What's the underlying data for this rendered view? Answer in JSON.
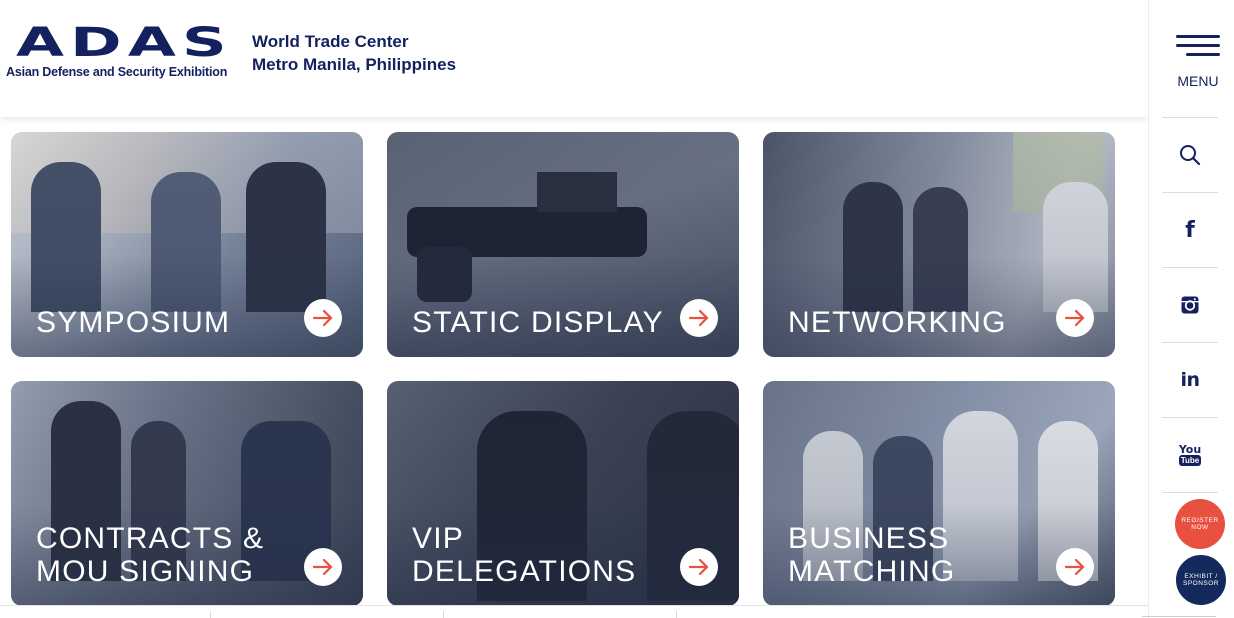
{
  "header": {
    "logo_text": "ADAS",
    "logo_subtitle": "Asian Defense and Security Exhibition",
    "venue_line1": "World Trade Center",
    "venue_line2": "Metro Manila, Philippines"
  },
  "sidebar": {
    "menu_label": "MENU",
    "items": [
      {
        "name": "search",
        "icon": "search-icon"
      },
      {
        "name": "facebook",
        "icon": "facebook-icon",
        "glyph": "f"
      },
      {
        "name": "instagram",
        "icon": "instagram-icon"
      },
      {
        "name": "linkedin",
        "icon": "linkedin-icon",
        "glyph": "in"
      },
      {
        "name": "youtube",
        "icon": "youtube-icon",
        "glyph_top": "You",
        "glyph_bottom": "Tube"
      }
    ],
    "register_line1": "REGISTER",
    "register_line2": "NOW",
    "exhibit_line1": "EXHIBIT /",
    "exhibit_line2": "SPONSOR"
  },
  "cards": [
    {
      "line1": "SYMPOSIUM",
      "line2": ""
    },
    {
      "line1": "STATIC DISPLAY",
      "line2": ""
    },
    {
      "line1": "NETWORKING",
      "line2": ""
    },
    {
      "line1": "CONTRACTS &",
      "line2": "MOU SIGNING"
    },
    {
      "line1": "VIP",
      "line2": "DELEGATIONS"
    },
    {
      "line1": "BUSINESS",
      "line2": "MATCHING"
    }
  ],
  "colors": {
    "brand_navy": "#13215f",
    "accent_red": "#e8503f",
    "exhibit_navy": "#142a5c"
  }
}
